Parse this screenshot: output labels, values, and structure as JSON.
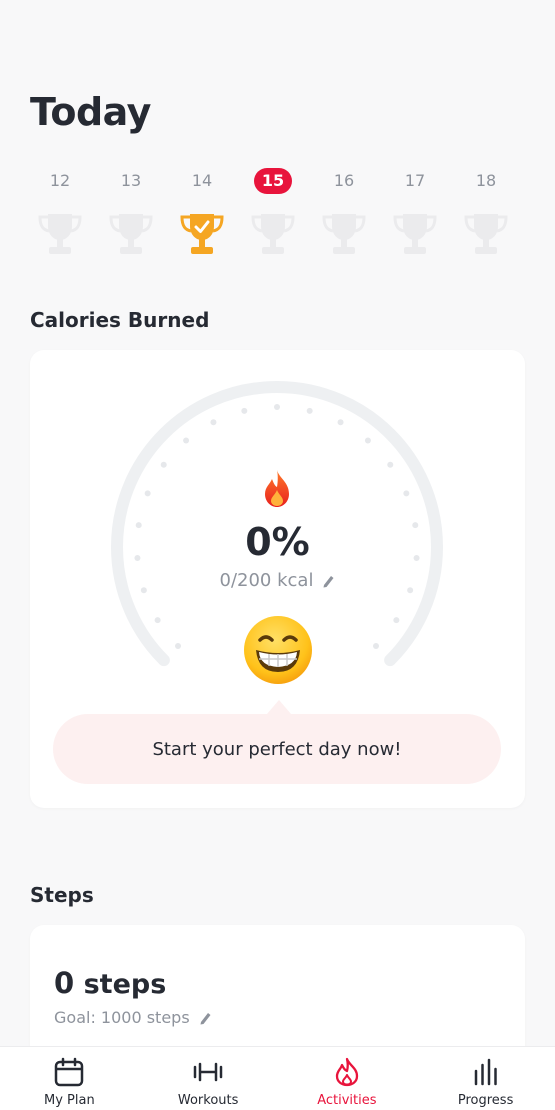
{
  "header": {
    "title": "Today"
  },
  "week": {
    "days": [
      {
        "num": "12",
        "state": "inactive"
      },
      {
        "num": "13",
        "state": "inactive"
      },
      {
        "num": "14",
        "state": "achieved"
      },
      {
        "num": "15",
        "state": "today"
      },
      {
        "num": "16",
        "state": "inactive"
      },
      {
        "num": "17",
        "state": "inactive"
      },
      {
        "num": "18",
        "state": "inactive"
      }
    ]
  },
  "calories": {
    "section_title": "Calories Burned",
    "percent": "0%",
    "progress": 0,
    "value_text": "0/200 kcal",
    "message": "Start your perfect day now!"
  },
  "steps": {
    "section_title": "Steps",
    "count": "0",
    "unit": "steps",
    "goal_text": "Goal: 1000 steps"
  },
  "nav": {
    "items": [
      {
        "label": "My Plan",
        "icon": "calendar-icon"
      },
      {
        "label": "Workouts",
        "icon": "dumbbell-icon"
      },
      {
        "label": "Activities",
        "icon": "flame-icon",
        "active": true
      },
      {
        "label": "Progress",
        "icon": "bar-chart-icon"
      }
    ]
  },
  "colors": {
    "accent": "#e8143c",
    "text": "#262a33",
    "muted": "#8e939c",
    "trophy_gold": "#f5a623",
    "trophy_inactive": "#ebebed"
  }
}
